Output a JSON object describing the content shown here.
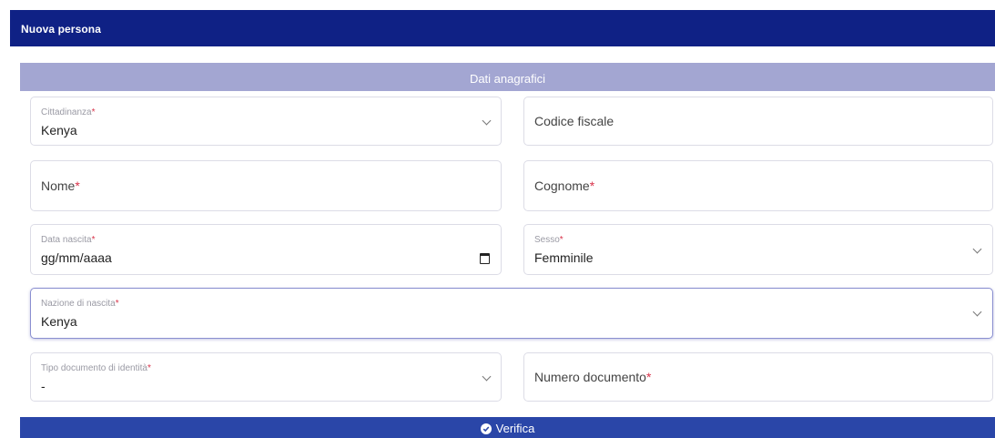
{
  "header": {
    "title": "Nuova persona"
  },
  "section": {
    "title": "Dati anagrafici"
  },
  "fields": {
    "cittadinanza": {
      "label": "Cittadinanza",
      "required": "*",
      "value": "Kenya"
    },
    "codice_fiscale": {
      "placeholder": "Codice fiscale"
    },
    "nome": {
      "placeholder": "Nome",
      "required": "*"
    },
    "cognome": {
      "placeholder": "Cognome",
      "required": "*"
    },
    "data_nascita": {
      "label": "Data nascita",
      "required": "*",
      "value": "gg/mm/aaaa"
    },
    "sesso": {
      "label": "Sesso",
      "required": "*",
      "value": "Femminile"
    },
    "nazione_nascita": {
      "label": "Nazione di nascita",
      "required": "*",
      "value": "Kenya"
    },
    "tipo_documento": {
      "label": "Tipo documento di identità",
      "required": "*",
      "value": "-"
    },
    "numero_documento": {
      "placeholder": "Numero documento",
      "required": "*"
    }
  },
  "actions": {
    "verify_label": "Verifica"
  },
  "colors": {
    "header": "#0f2185",
    "section": "#a3a6d2",
    "button": "#2a46a8",
    "required": "#d8334a"
  }
}
